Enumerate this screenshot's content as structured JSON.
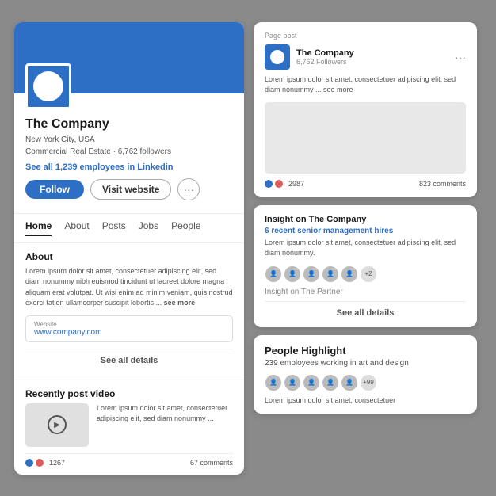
{
  "left": {
    "company_name": "The Company",
    "meta_line1": "New York City, USA",
    "meta_line2": "Commercial Real Estate · 6,762 followers",
    "employees_link": "See all 1,239 employees in Linkedin",
    "follow_label": "Follow",
    "visit_label": "Visit website",
    "more_icon": "···",
    "nav": {
      "tabs": [
        "Home",
        "About",
        "Posts",
        "Jobs",
        "People"
      ],
      "active": "Home"
    },
    "about": {
      "title": "About",
      "text": "Lorem ipsum dolor sit amet, consectetuer adipiscing elit, sed diam nonummy nibh euismod tincidunt ut laoreet dolore magna aliquam erat volutpat. Ut wisi enim ad minim veniam, quis nostrud exerci tation ullamcorper suscipit lobortis ...",
      "see_more": "see more",
      "website_label": "Website",
      "website_url": "www.company.com",
      "see_all_details": "See all details"
    },
    "video": {
      "title": "Recently post video",
      "text": "Lorem ipsum dolor sit amet, consectetuer adipiscing elit, sed diam nonummy ...",
      "likes_count": "1267",
      "comments": "67 comments"
    }
  },
  "right": {
    "page_post": {
      "label": "Page post",
      "company_name": "The Company",
      "followers": "6,762 Followers",
      "more_icon": "···",
      "text": "Lorem ipsum dolor sit amet, consectetuer adipiscing elit, sed diam nonummy ... see more",
      "likes_count": "2987",
      "comments": "823 comments"
    },
    "insight": {
      "title": "Insight on The Company",
      "subtitle": "6 recent senior management hires",
      "text": "Lorem ipsum dolor sit amet, consectetuer adipiscing elit, sed diam nonummy.",
      "avatars_extra": "+2",
      "partner_label": "Insight on The Partner",
      "see_all": "See all details"
    },
    "people": {
      "title": "People Highlight",
      "subtitle": "239 employees working in art and design",
      "avatars_extra": "+99",
      "text": "Lorem ipsum dolor sit amet, consectetuer"
    }
  },
  "icons": {
    "play": "▶",
    "dots": "•••"
  }
}
